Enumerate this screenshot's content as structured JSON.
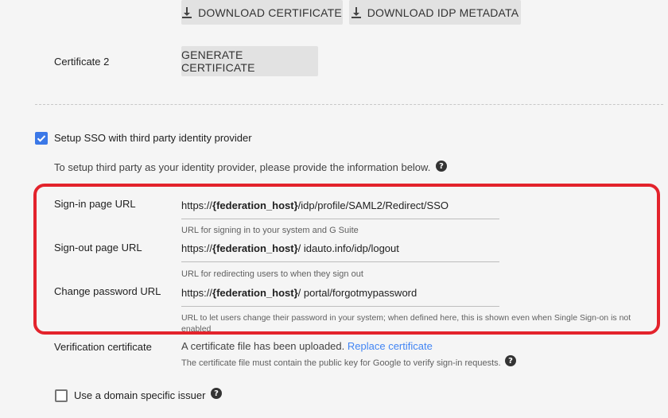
{
  "top_buttons": {
    "download_certificate": "DOWNLOAD CERTIFICATE",
    "download_idp_metadata": "DOWNLOAD IDP METADATA"
  },
  "certificate2": {
    "label": "Certificate 2",
    "generate_button": "GENERATE CERTIFICATE"
  },
  "sso": {
    "checkbox_label": "Setup SSO with third party identity provider",
    "checked": true,
    "intro": "To setup third party as your identity provider, please provide the information below."
  },
  "fields": {
    "signin": {
      "label": "Sign-in page URL",
      "value_prefix": "https://",
      "value_host": "{federation_host}",
      "value_suffix": "/idp/profile/SAML2/Redirect/SSO",
      "hint": "URL for signing in to your system and G Suite"
    },
    "signout": {
      "label": "Sign-out page URL",
      "value_prefix": "https://",
      "value_host": "{federation_host}",
      "value_suffix": "/ idauto.info/idp/logout",
      "hint": "URL for redirecting users to when they sign out"
    },
    "change_password": {
      "label": "Change password URL",
      "value_prefix": "https://",
      "value_host": "{federation_host}",
      "value_suffix": "/ portal/forgotmypassword",
      "hint_line1": "URL to let users change their password in your system; when defined here, this is shown even when Single Sign-on is not",
      "hint_line2": "enabled"
    }
  },
  "verification": {
    "label": "Verification certificate",
    "status": "A certificate file has been uploaded.",
    "replace_link": "Replace certificate",
    "hint": "The certificate file must contain the public key for Google to verify sign-in requests."
  },
  "domain_issuer": {
    "label": "Use a domain specific issuer",
    "checked": false
  },
  "colors": {
    "accent": "#3b78e7",
    "link": "#4285f4",
    "highlight_border": "#e3232c"
  }
}
